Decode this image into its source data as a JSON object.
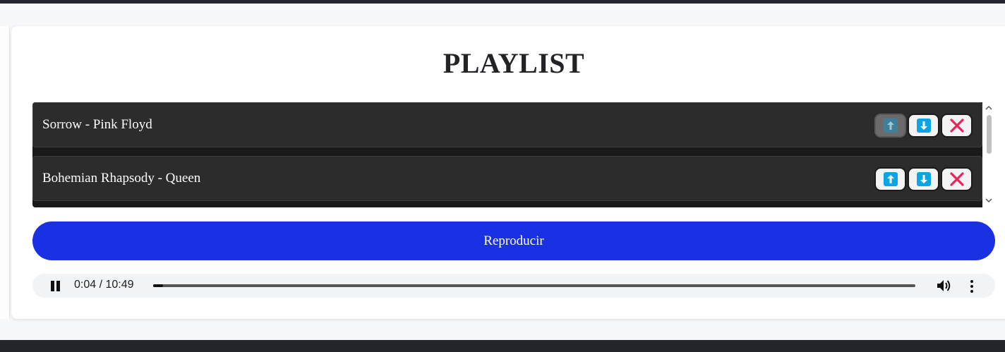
{
  "title": "PLAYLIST",
  "tracks": [
    {
      "label": "Sorrow - Pink Floyd",
      "up_disabled": true
    },
    {
      "label": "Bohemian Rhapsody - Queen",
      "up_disabled": false
    }
  ],
  "track_button_icons": {
    "up": "arrow-up-icon",
    "down": "arrow-down-icon",
    "remove": "close-icon"
  },
  "play_button_label": "Reproducir",
  "audio": {
    "time": "0:04 / 10:49",
    "progress_fraction": 0.006,
    "state": "playing"
  },
  "colors": {
    "accent": "#1a30e3",
    "arrow": "#0ba4e4",
    "remove": "#e8245a",
    "track_bg": "#2c2c2c"
  }
}
